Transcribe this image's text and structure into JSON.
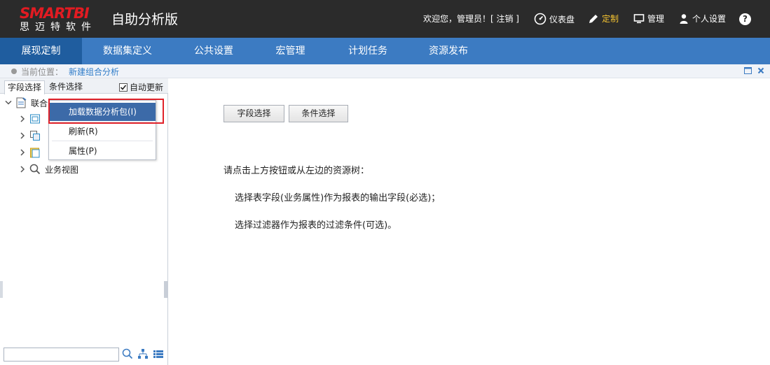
{
  "header": {
    "logo_text": "SMARTBI",
    "logo_cn": "思迈特软件",
    "app_title": "自助分析版",
    "welcome": "欢迎您，管理员！[ 注销 ]",
    "links": [
      {
        "label": "仪表盘",
        "icon": "dashboard-icon"
      },
      {
        "label": "定制",
        "icon": "pencil-icon",
        "active": true
      },
      {
        "label": "管理",
        "icon": "monitor-icon"
      },
      {
        "label": "个人设置",
        "icon": "user-icon"
      }
    ],
    "help": "?",
    "accent_active": "#f7c531"
  },
  "nav": {
    "items": [
      {
        "label": "展现定制",
        "active": true
      },
      {
        "label": "数据集定义"
      },
      {
        "label": "公共设置"
      },
      {
        "label": "宏管理"
      },
      {
        "label": "计划任务"
      },
      {
        "label": "资源发布"
      }
    ],
    "bg": "#3c7bc2",
    "active_bg": "#1f5d9f"
  },
  "breadcrumb": {
    "label": "当前位置：",
    "current": "新建组合分析"
  },
  "left_panel": {
    "tabs": [
      "字段选择",
      "条件选择"
    ],
    "auto_update": {
      "label": "自动更新",
      "checked": true
    },
    "tree": {
      "root": "联合",
      "children": [
        {
          "icon": "table-icon",
          "label": ""
        },
        {
          "icon": "dataset-icon",
          "label": ""
        },
        {
          "icon": "folder-icon",
          "label": ""
        },
        {
          "icon": "search-icon",
          "label": "业务视图"
        }
      ]
    },
    "search": {
      "value": "",
      "placeholder": ""
    }
  },
  "context_menu": {
    "items": [
      {
        "label": "加载数据分析包(I)",
        "highlighted": true
      },
      {
        "label": "刷新(R)"
      },
      {
        "label": "属性(P)"
      }
    ]
  },
  "main": {
    "buttons": [
      "字段选择",
      "条件选择"
    ],
    "hint_lines": [
      "请点击上方按钮或从左边的资源树：",
      "选择表字段(业务属性)作为报表的输出字段(必选)；",
      "选择过滤器作为报表的过滤条件(可选)。"
    ]
  }
}
